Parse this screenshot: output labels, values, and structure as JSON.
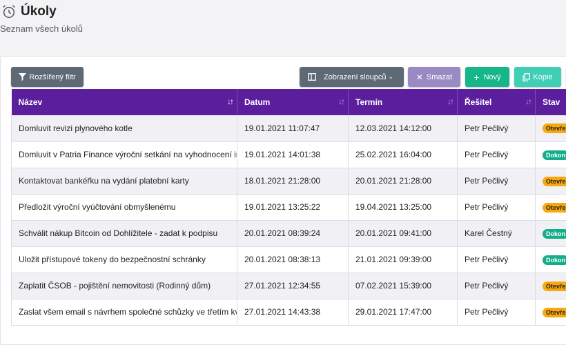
{
  "header": {
    "title": "Úkoly",
    "subtitle": "Seznam všech úkolů",
    "icon": "alarm-clock-icon"
  },
  "toolbar": {
    "filter_label": "Rozšířený filtr",
    "columns_label": "Zobrazení sloupců",
    "delete_label": "Smazat",
    "new_label": "Nový",
    "copy_label": "Kopie"
  },
  "colors": {
    "header_bg": "#5b1f9e",
    "badge_open": "#f6a80f",
    "badge_done": "#14ad8a"
  },
  "table": {
    "columns": [
      "Název",
      "Datum",
      "Termín",
      "Řešitel",
      "Stav"
    ],
    "rows": [
      {
        "name": "Domluvit revizi plynového kotle",
        "date": "19.01.2021 11:07:47",
        "deadline": "12.03.2021 14:12:00",
        "assignee": "Petr Pečlivý",
        "status": "Otevře",
        "status_type": "open"
      },
      {
        "name": "Domluvit v Patria Finance výroční setkání na vyhodnocení in",
        "date": "19.01.2021 14:01:38",
        "deadline": "25.02.2021 16:04:00",
        "assignee": "Petr Pečlivý",
        "status": "Dokon",
        "status_type": "done"
      },
      {
        "name": "Kontaktovat bankéřku na vydání platební karty",
        "date": "18.01.2021 21:28:00",
        "deadline": "20.01.2021 21:28:00",
        "assignee": "Petr Pečlivý",
        "status": "Otevře",
        "status_type": "open"
      },
      {
        "name": "Předložit výroční vyúčtování obmyšlenému",
        "date": "19.01.2021 13:25:22",
        "deadline": "19.04.2021 13:25:00",
        "assignee": "Petr Pečlivý",
        "status": "Otevře",
        "status_type": "open"
      },
      {
        "name": "Schválit nákup Bitcoin od Dohlížitele - zadat k podpisu",
        "date": "20.01.2021 08:39:24",
        "deadline": "20.01.2021 09:41:00",
        "assignee": "Karel Čestný",
        "status": "Dokon",
        "status_type": "done"
      },
      {
        "name": "Uložit přístupové tokeny do bezpečnostní schránky",
        "date": "20.01.2021 08:38:13",
        "deadline": "21.01.2021 09:39:00",
        "assignee": "Petr Pečlivý",
        "status": "Dokon",
        "status_type": "done"
      },
      {
        "name": "Zaplatit ČSOB - pojištění nemovitosti (Rodinný dům)",
        "date": "27.01.2021 12:34:55",
        "deadline": "07.02.2021 15:39:00",
        "assignee": "Petr Pečlivý",
        "status": "Otevře",
        "status_type": "open"
      },
      {
        "name": "Zaslat všem email s návrhem společné schůzky ve třetím kv",
        "date": "27.01.2021 14:43:38",
        "deadline": "29.01.2021 17:47:00",
        "assignee": "Petr Pečlivý",
        "status": "Otevře",
        "status_type": "open"
      }
    ]
  }
}
